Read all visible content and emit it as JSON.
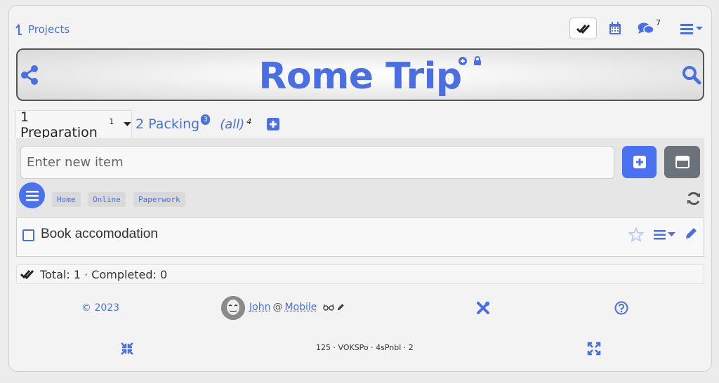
{
  "nav": {
    "projects_label": "Projects",
    "messages_count": "7"
  },
  "board": {
    "title": "Rome Trip"
  },
  "tabs": [
    {
      "label": "1 Preparation",
      "count": "1"
    },
    {
      "label": "2 Packing",
      "badge": "3"
    },
    {
      "label": "(all)",
      "count": "4"
    }
  ],
  "new_item": {
    "placeholder": "Enter new item"
  },
  "tags": [
    "Home",
    "Online",
    "Paperwork"
  ],
  "items": [
    {
      "label": "Book accomodation"
    }
  ],
  "totals": {
    "text": "Total: 1 · Completed: 0"
  },
  "footer": {
    "copyright": "© 2023",
    "user": "John",
    "at": "@",
    "device": "Mobile",
    "version": "125 · VOKSPo · 4sPnbl · 2"
  },
  "colors": {
    "accent": "#4a6fe3",
    "button_blue": "#4a72f0",
    "button_gray": "#6c727a"
  }
}
